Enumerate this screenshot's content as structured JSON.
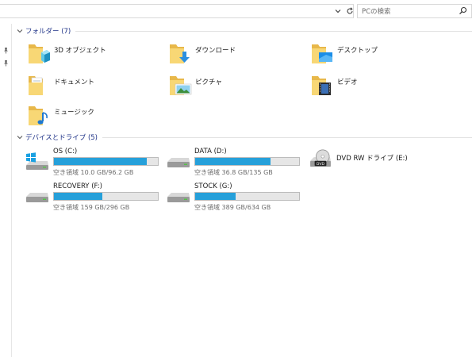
{
  "search": {
    "placeholder": "PCの検索"
  },
  "groups": {
    "folders": {
      "label": "フォルダー (7)"
    },
    "devices": {
      "label": "デバイスとドライブ (5)"
    }
  },
  "folders": [
    {
      "label": "3D オブジェクト",
      "icon": "3d-objects-icon"
    },
    {
      "label": "ダウンロード",
      "icon": "downloads-icon"
    },
    {
      "label": "デスクトップ",
      "icon": "desktop-icon"
    },
    {
      "label": "ドキュメント",
      "icon": "documents-icon"
    },
    {
      "label": "ピクチャ",
      "icon": "pictures-icon"
    },
    {
      "label": "ビデオ",
      "icon": "videos-icon"
    },
    {
      "label": "ミュージック",
      "icon": "music-icon"
    }
  ],
  "drives": [
    {
      "name": "OS (C:)",
      "free": "空き領域 10.0 GB/96.2 GB",
      "used_fraction": 0.896,
      "icon": "windows-drive-icon"
    },
    {
      "name": "DATA (D:)",
      "free": "空き領域 36.8 GB/135 GB",
      "used_fraction": 0.727,
      "icon": "hard-drive-icon"
    },
    {
      "name": "DVD RW ドライブ (E:)",
      "icon": "dvd-drive-icon"
    },
    {
      "name": "RECOVERY (F:)",
      "free": "空き領域 159 GB/296 GB",
      "used_fraction": 0.463,
      "icon": "hard-drive-icon"
    },
    {
      "name": "STOCK (G:)",
      "free": "空き領域 389 GB/634 GB",
      "used_fraction": 0.386,
      "icon": "hard-drive-icon"
    }
  ],
  "colors": {
    "bar_fill": "#26a0da",
    "header_text": "#1e3287",
    "folder": "#f8d775"
  }
}
